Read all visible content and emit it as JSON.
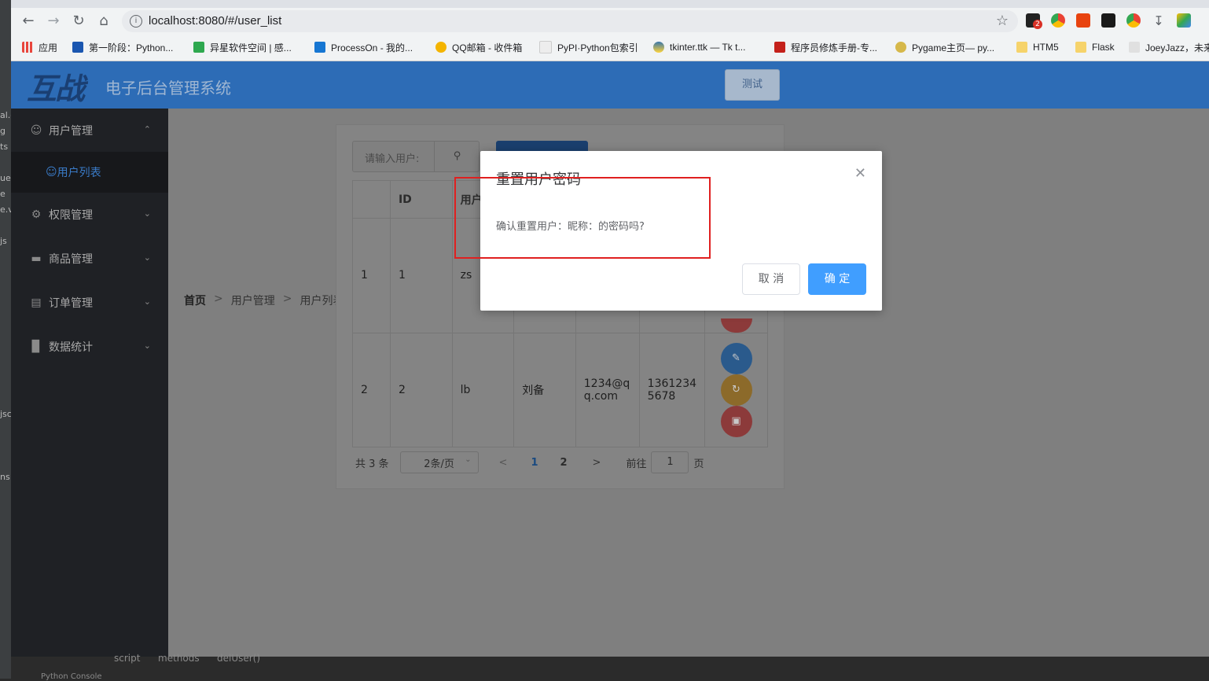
{
  "browser": {
    "url": "localhost:8080/#/user_list",
    "ext_badge": "2",
    "bookmarks": [
      "应用",
      "第一阶段：Python...",
      "异星软件空间 | 感...",
      "ProcessOn - 我的...",
      "QQ邮箱 - 收件箱",
      "PyPI·Python包索引",
      "tkinter.ttk — Tk t...",
      "程序员修炼手册-专...",
      "Pygame主页— py...",
      "HTM5",
      "Flask",
      "JoeyJazz，未来"
    ]
  },
  "header": {
    "logo_text": "互战",
    "title": "电子后台管理系统",
    "test_button": "测试"
  },
  "sidebar": {
    "user_mgmt": "用户管理",
    "user_list": "用户列表",
    "perm_mgmt": "权限管理",
    "goods_mgmt": "商品管理",
    "order_mgmt": "订单管理",
    "stats": "数据统计"
  },
  "breadcrumb": [
    "首页",
    "用户管理",
    "用户列表"
  ],
  "search": {
    "placeholder": "请输入用户:"
  },
  "table": {
    "headers": [
      "",
      "ID",
      "用户"
    ],
    "rows": [
      [
        "1",
        "1",
        "zs",
        "",
        "",
        ""
      ],
      [
        "2",
        "2",
        "lb",
        "刘备",
        "1234@q q.com",
        "1361234 5678"
      ]
    ]
  },
  "pagination": {
    "total": "共 3 条",
    "page_size": "2条/页",
    "pages": [
      "1",
      "2"
    ],
    "goto_label": "前往",
    "goto_value": "1",
    "page_suffix": "页"
  },
  "dialog": {
    "title": "重置用户密码",
    "message": "确认重置用户：昵称：的密码吗?",
    "cancel": "取 消",
    "confirm": "确 定"
  },
  "ide": {
    "left_fragments": [
      "al.c",
      "g",
      "ts",
      "ue",
      "e",
      "e.v",
      "js",
      "jsc",
      "ns"
    ],
    "bottom_path": [
      "script",
      "methods",
      "delUser()"
    ],
    "bottom_panel": "Python Console"
  },
  "colors": {
    "header_bg": "#2d6cb6",
    "sidebar_bg": "#1f2125",
    "primary": "#409eff",
    "annotation": "#e02020"
  }
}
